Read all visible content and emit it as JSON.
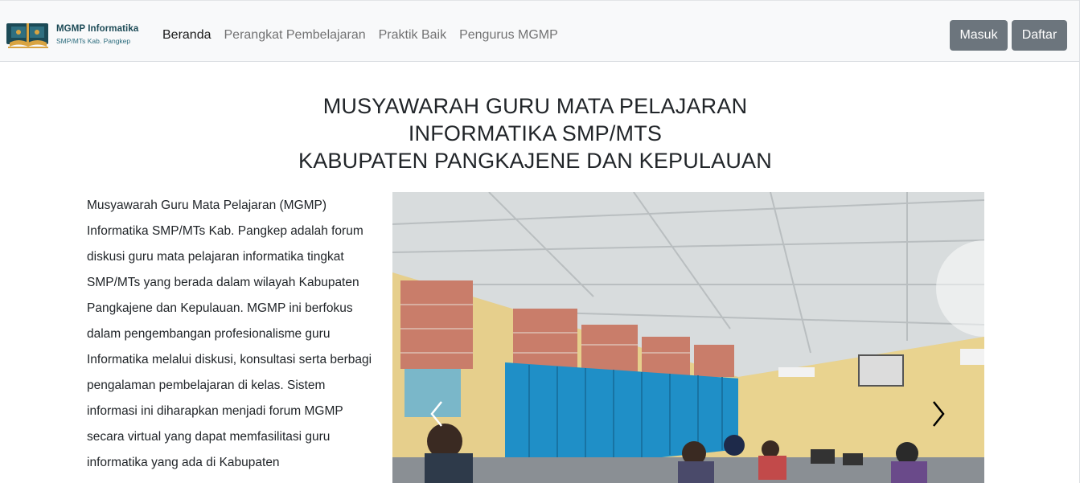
{
  "brand": {
    "title": "MGMP Informatika",
    "subtitle": "SMP/MTs Kab. Pangkep"
  },
  "nav": {
    "items": [
      {
        "label": "Beranda",
        "active": true
      },
      {
        "label": "Perangkat Pembelajaran",
        "active": false
      },
      {
        "label": "Praktik Baik",
        "active": false
      },
      {
        "label": "Pengurus MGMP",
        "active": false
      }
    ]
  },
  "auth": {
    "login_label": "Masuk",
    "register_label": "Daftar"
  },
  "hero": {
    "heading_lines": [
      "MUSYAWARAH GURU MATA PELAJARAN",
      "INFORMATIKA SMP/MTS",
      "KABUPATEN PANGKAJENE DAN KEPULAUAN"
    ],
    "description": "Musyawarah Guru Mata Pelajaran (MGMP) Informatika SMP/MTs Kab. Pangkep adalah forum diskusi guru mata pelajaran informatika tingkat SMP/MTs yang berada dalam wilayah Kabupaten Pangkajene dan Kepulauan. MGMP ini berfokus dalam pengembangan profesionalisme guru Informatika melalui diskusi, konsultasi serta berbagi pengalaman pembelajaran di kelas. Sistem informasi ini diharapkan menjadi forum MGMP secara virtual yang dapat memfasilitasi guru informatika yang ada di Kabupaten"
  },
  "carousel": {
    "prev_icon": "chevron-left-icon",
    "next_icon": "chevron-right-icon"
  },
  "colors": {
    "navbar_bg": "#f8f9fa",
    "button_bg": "#6c757d",
    "curtain": "#1f8fc7",
    "wall": "#e6cf8c"
  }
}
